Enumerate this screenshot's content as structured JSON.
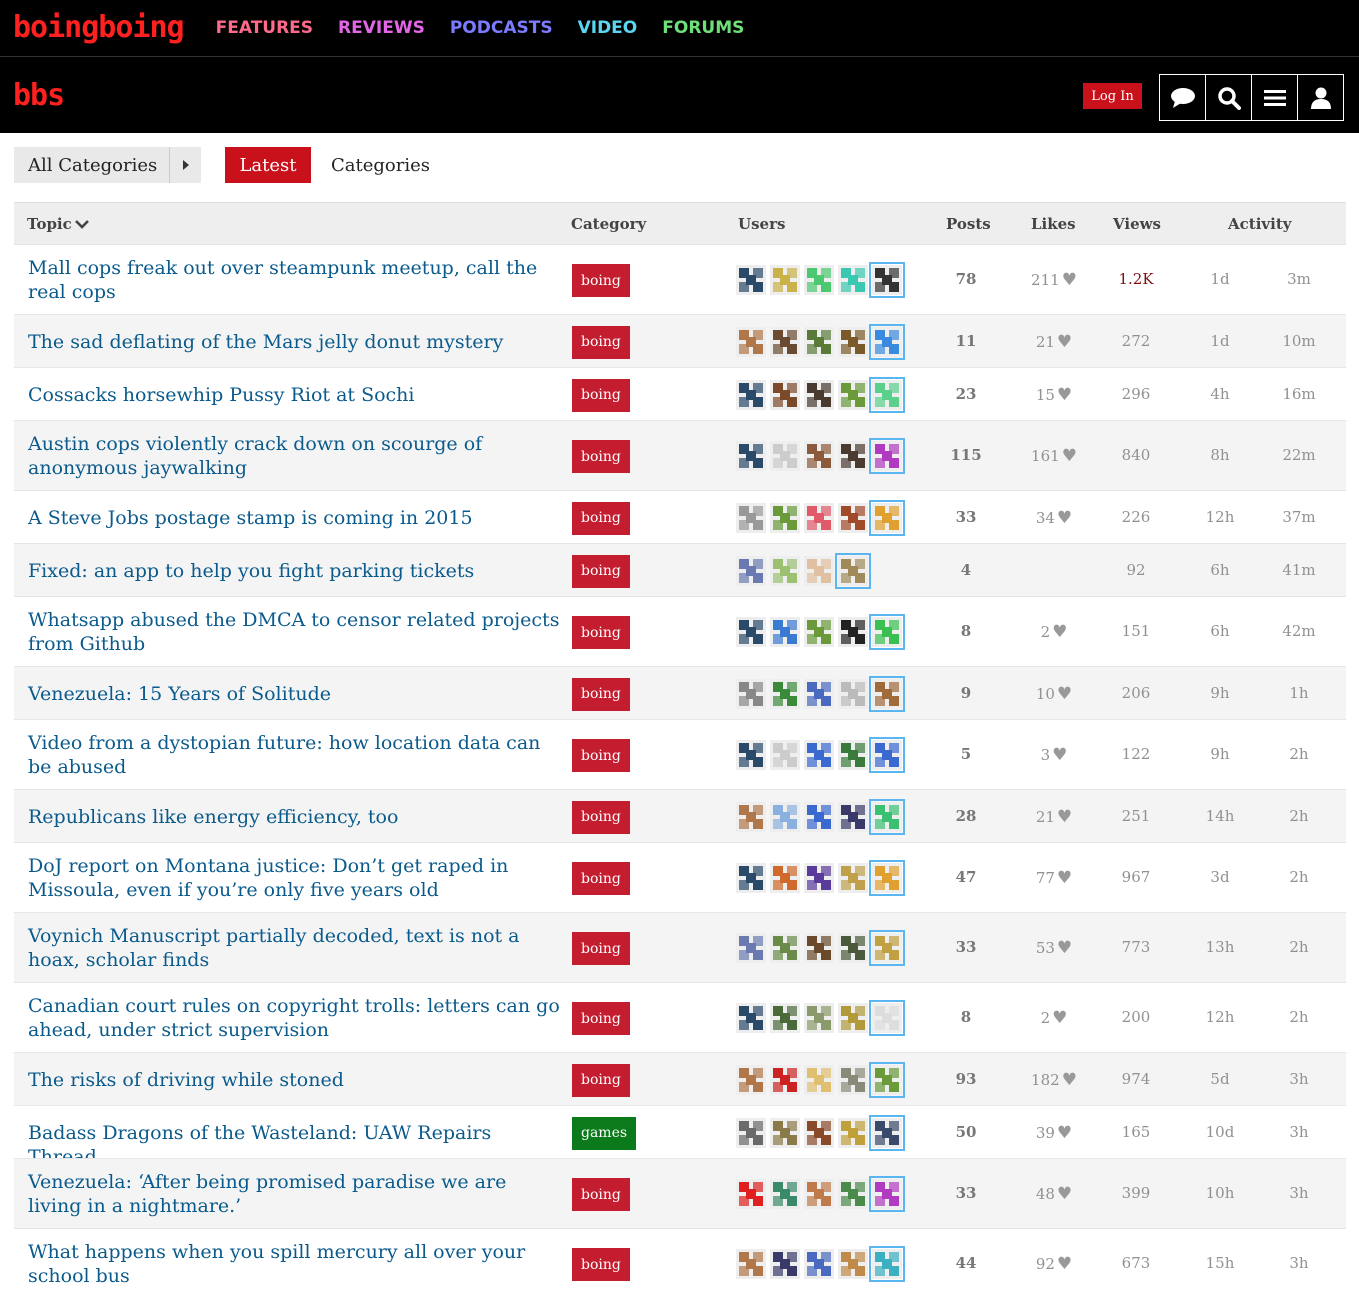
{
  "brand": {
    "logo": "boingboing",
    "bbs_logo": "bbs"
  },
  "topnav": [
    {
      "label": "FEATURES",
      "color": "#ff6a8a"
    },
    {
      "label": "REVIEWS",
      "color": "#e266e6"
    },
    {
      "label": "PODCASTS",
      "color": "#7b7bff"
    },
    {
      "label": "VIDEO",
      "color": "#5bd6f0"
    },
    {
      "label": "FORUMS",
      "color": "#6ee07a"
    }
  ],
  "header": {
    "login_label": "Log In"
  },
  "filters": {
    "all_categories": "All Categories",
    "latest": "Latest",
    "categories": "Categories"
  },
  "columns": {
    "topic": "Topic",
    "category": "Category",
    "users": "Users",
    "posts": "Posts",
    "likes": "Likes",
    "views": "Views",
    "activity": "Activity"
  },
  "accent": "#c9111c",
  "topics": [
    {
      "title": "Mall cops freak out over steampunk meetup, call the real cops",
      "category": "boing",
      "posts": "78",
      "likes": "211",
      "views": "1.2K",
      "created": "1d",
      "last": "3m",
      "avatars": [
        "#2b4a6a",
        "#c9b24a",
        "#4ac970",
        "#3ac9b0",
        "#333333"
      ]
    },
    {
      "title": "The sad deflating of the Mars jelly donut mystery",
      "category": "boing",
      "posts": "11",
      "likes": "21",
      "views": "272",
      "created": "1d",
      "last": "10m",
      "avatars": [
        "#b0784a",
        "#6a4a30",
        "#5a7a3a",
        "#7a5a2a",
        "#3a8ae0"
      ]
    },
    {
      "title": "Cossacks horsewhip Pussy Riot at Sochi",
      "category": "boing",
      "posts": "23",
      "likes": "15",
      "views": "296",
      "created": "4h",
      "last": "16m",
      "avatars": [
        "#2b4a6a",
        "#7a4a2a",
        "#4a3a30",
        "#6a9a3a",
        "#5ad08a"
      ]
    },
    {
      "title": "Austin cops violently crack down on scourge of anonymous jaywalking",
      "category": "boing",
      "posts": "115",
      "likes": "161",
      "views": "840",
      "created": "8h",
      "last": "22m",
      "avatars": [
        "#2b4a6a",
        "#cccccc",
        "#8a5a3a",
        "#4a3a30",
        "#b03ac0"
      ]
    },
    {
      "title": "A Steve Jobs postage stamp is coming in 2015",
      "category": "boing",
      "posts": "33",
      "likes": "34",
      "views": "226",
      "created": "12h",
      "last": "37m",
      "avatars": [
        "#999999",
        "#6a9a3a",
        "#e05a6a",
        "#a04a2a",
        "#e0a030"
      ]
    },
    {
      "title": "Fixed: an app to help you fight parking tickets",
      "category": "boing",
      "posts": "4",
      "likes": "",
      "views": "92",
      "created": "6h",
      "last": "41m",
      "avatars": [
        "#6a7ab0",
        "#9ac070",
        "#e0c0a0",
        "#a08a5a"
      ]
    },
    {
      "title": "Whatsapp abused the DMCA to censor related projects from Github",
      "category": "boing",
      "posts": "8",
      "likes": "2",
      "views": "151",
      "created": "6h",
      "last": "42m",
      "avatars": [
        "#2b4a6a",
        "#3a7ad0",
        "#6a9a3a",
        "#222222",
        "#3ac050"
      ]
    },
    {
      "title": "Venezuela: 15 Years of Solitude",
      "category": "boing",
      "posts": "9",
      "likes": "10",
      "views": "206",
      "created": "9h",
      "last": "1h",
      "avatars": [
        "#888888",
        "#3a8a3a",
        "#4a6ac0",
        "#bbbbbb",
        "#a06a3a"
      ]
    },
    {
      "title": "Video from a dystopian future: how location data can be abused",
      "category": "boing",
      "posts": "5",
      "likes": "3",
      "views": "122",
      "created": "9h",
      "last": "2h",
      "avatars": [
        "#2b4a6a",
        "#cccccc",
        "#3a6ad0",
        "#3a7a3a",
        "#3a6ad0"
      ]
    },
    {
      "title": "Republicans like energy efficiency, too",
      "category": "boing",
      "posts": "28",
      "likes": "21",
      "views": "251",
      "created": "14h",
      "last": "2h",
      "avatars": [
        "#b0784a",
        "#8ab0e0",
        "#3a6ad0",
        "#3a3a6a",
        "#3ac070"
      ]
    },
    {
      "title": "DoJ report on Montana justice: Don’t get raped in Missoula, even if you’re only five years old",
      "category": "boing",
      "posts": "47",
      "likes": "77",
      "views": "967",
      "created": "3d",
      "last": "2h",
      "avatars": [
        "#2b4a6a",
        "#d06a2a",
        "#5a3a9a",
        "#c0a04a",
        "#e0a030"
      ]
    },
    {
      "title": "Voynich Manuscript partially decoded, text is not a hoax, scholar finds",
      "category": "boing",
      "posts": "33",
      "likes": "53",
      "views": "773",
      "created": "13h",
      "last": "2h",
      "avatars": [
        "#6a7ab0",
        "#6a8a4a",
        "#6a4a2a",
        "#4a5a3a",
        "#c0a040"
      ]
    },
    {
      "title": "Canadian court rules on copyright trolls: letters can go ahead, under strict supervision",
      "category": "boing",
      "posts": "8",
      "likes": "2",
      "views": "200",
      "created": "12h",
      "last": "2h",
      "avatars": [
        "#2b4a6a",
        "#4a6a3a",
        "#8a9a6a",
        "#b09a3a",
        "#dddddd"
      ]
    },
    {
      "title": "The risks of driving while stoned",
      "category": "boing",
      "posts": "93",
      "likes": "182",
      "views": "974",
      "created": "5d",
      "last": "3h",
      "avatars": [
        "#b0784a",
        "#cc2222",
        "#e0c070",
        "#8a8a7a",
        "#6a9a3a"
      ]
    },
    {
      "title": "Badass Dragons of the Wasteland: UAW Repairs Thread",
      "category": "games",
      "posts": "50",
      "likes": "39",
      "views": "165",
      "created": "10d",
      "last": "3h",
      "avatars": [
        "#6a6a6a",
        "#8a7a4a",
        "#8a4a2a",
        "#c0a03a",
        "#3a4a6a"
      ]
    },
    {
      "title": "Venezuela: ‘After being promised paradise we are living in a nightmare.’",
      "category": "boing",
      "posts": "33",
      "likes": "48",
      "views": "399",
      "created": "10h",
      "last": "3h",
      "avatars": [
        "#e02020",
        "#3a8a6a",
        "#c07a4a",
        "#4a8a4a",
        "#b03ac0"
      ]
    },
    {
      "title": "What happens when you spill mercury all over your school bus",
      "category": "boing",
      "posts": "44",
      "likes": "92",
      "views": "673",
      "created": "15h",
      "last": "3h",
      "avatars": [
        "#b0784a",
        "#3a3a6a",
        "#4a6ac0",
        "#c08a4a",
        "#3ab0c0"
      ]
    }
  ],
  "category_colors": {
    "boing": "#c41d30",
    "games": "#0b7a1a"
  }
}
